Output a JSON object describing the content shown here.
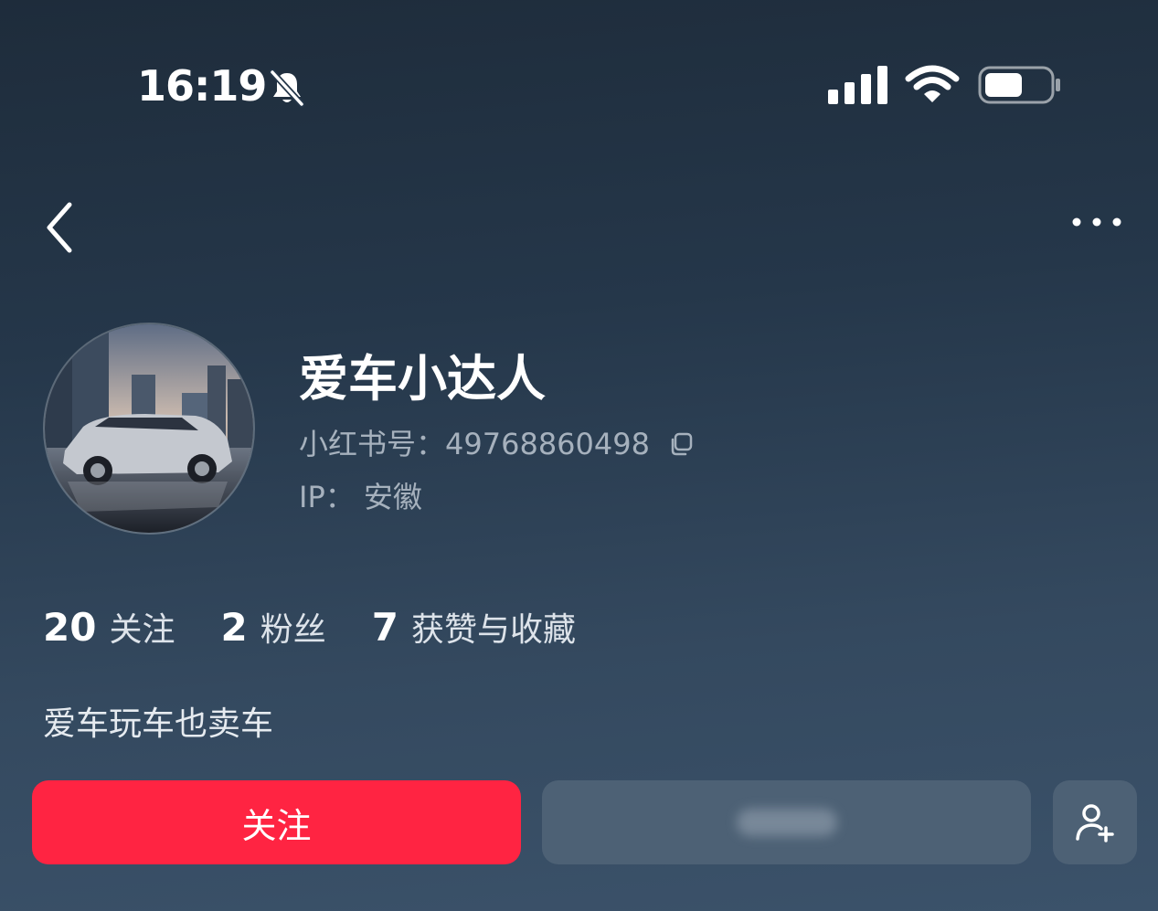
{
  "status_bar": {
    "time": "16:19",
    "icons": [
      "bell-slash-icon",
      "cellular-signal-icon",
      "wifi-icon",
      "battery-icon"
    ]
  },
  "nav": {
    "back_icon": "chevron-left-icon",
    "more_icon": "more-dots-icon"
  },
  "profile": {
    "avatar": "car-photo-avatar",
    "username": "爱车小达人",
    "id_label": "小红书号：",
    "id_value": "49768860498",
    "ip_label": "IP：",
    "ip_value": "安徽",
    "bio": "爱车玩车也卖车"
  },
  "stats": [
    {
      "value": "20",
      "label": "关注"
    },
    {
      "value": "2",
      "label": "粉丝"
    },
    {
      "value": "7",
      "label": "获赞与收藏"
    }
  ],
  "actions": {
    "follow_label": "关注",
    "add_friend_icon": "add-user-icon"
  },
  "colors": {
    "accent": "#ff2442",
    "secondary_button": "#4d6175",
    "muted_text": "#a6b1bd"
  }
}
